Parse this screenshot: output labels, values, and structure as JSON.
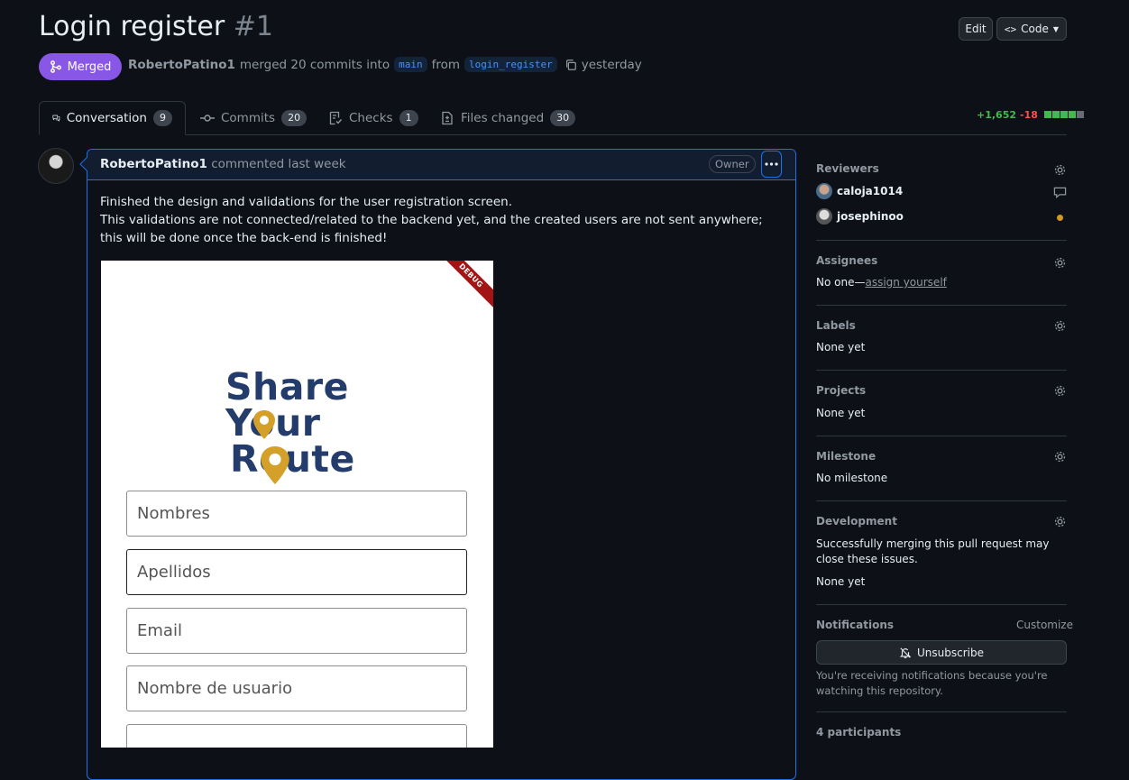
{
  "pr": {
    "title": "Login register",
    "number": "#1",
    "status": "Merged",
    "author": "RobertoPatino1",
    "merged_text": "merged 20 commits into",
    "base_branch": "main",
    "from_text": "from",
    "head_branch": "login_register",
    "time": "yesterday"
  },
  "header_buttons": {
    "edit": "Edit",
    "code": "Code"
  },
  "tabs": [
    {
      "label": "Conversation",
      "count": "9"
    },
    {
      "label": "Commits",
      "count": "20"
    },
    {
      "label": "Checks",
      "count": "1"
    },
    {
      "label": "Files changed",
      "count": "30"
    }
  ],
  "diffstat": {
    "additions": "+1,652",
    "deletions": "-18"
  },
  "comment": {
    "author": "RobertoPatino1",
    "action": "commented last week",
    "badge": "Owner",
    "line1": "Finished the design and validations for the user registration screen.",
    "line2": "This validations are not connected/related to the backend yet, and the created users are not sent anywhere; this will be done once the back-end is finished!"
  },
  "phone": {
    "debug_label": "DEBUG",
    "logo": [
      "Share",
      "Your",
      "Route"
    ],
    "fields": [
      "Nombres",
      "Apellidos",
      "Email",
      "Nombre de usuario"
    ]
  },
  "sidebar": {
    "reviewers": {
      "title": "Reviewers",
      "people": [
        "caloja1014",
        "josephinoo"
      ]
    },
    "assignees": {
      "title": "Assignees",
      "none": "No one—",
      "link": "assign yourself"
    },
    "labels": {
      "title": "Labels",
      "value": "None yet"
    },
    "projects": {
      "title": "Projects",
      "value": "None yet"
    },
    "milestone": {
      "title": "Milestone",
      "value": "No milestone"
    },
    "development": {
      "title": "Development",
      "desc": "Successfully merging this pull request may close these issues.",
      "value": "None yet"
    },
    "notifications": {
      "title": "Notifications",
      "customize": "Customize",
      "button": "Unsubscribe",
      "desc": "You're receiving notifications because you're watching this repository."
    },
    "participants": "4 participants"
  },
  "colors": {
    "accent": "#1f6feb",
    "merged": "#8957e5",
    "add": "#3fb950",
    "del": "#f85149",
    "pending": "#d29922"
  }
}
